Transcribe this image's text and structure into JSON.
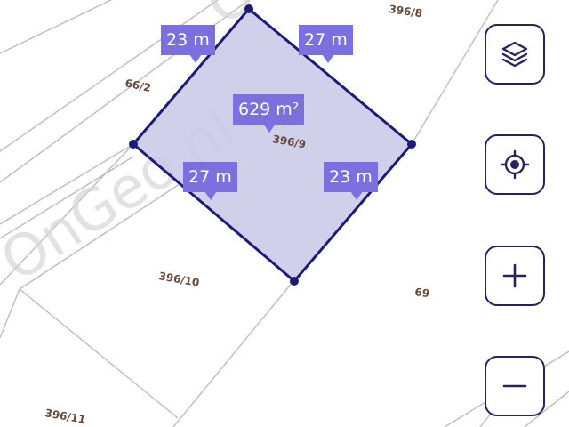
{
  "map": {
    "watermark": "OnGeo.nl",
    "parcels": [
      "396/8",
      "66/2",
      "396/9",
      "396/10",
      "69",
      "396/11"
    ],
    "selection": {
      "area": "629 m²",
      "edges": [
        "23 m",
        "27 m",
        "27 m",
        "23 m"
      ],
      "outline_color": "#1e1a7a",
      "fill_color": "#c8c8e6",
      "label_color": "#7c6fe0"
    }
  },
  "controls": [
    {
      "name": "layers",
      "icon": "layers-icon"
    },
    {
      "name": "my-location",
      "icon": "locate-icon"
    },
    {
      "name": "zoom-in",
      "icon": "plus-icon"
    },
    {
      "name": "zoom-out",
      "icon": "minus-icon"
    }
  ]
}
